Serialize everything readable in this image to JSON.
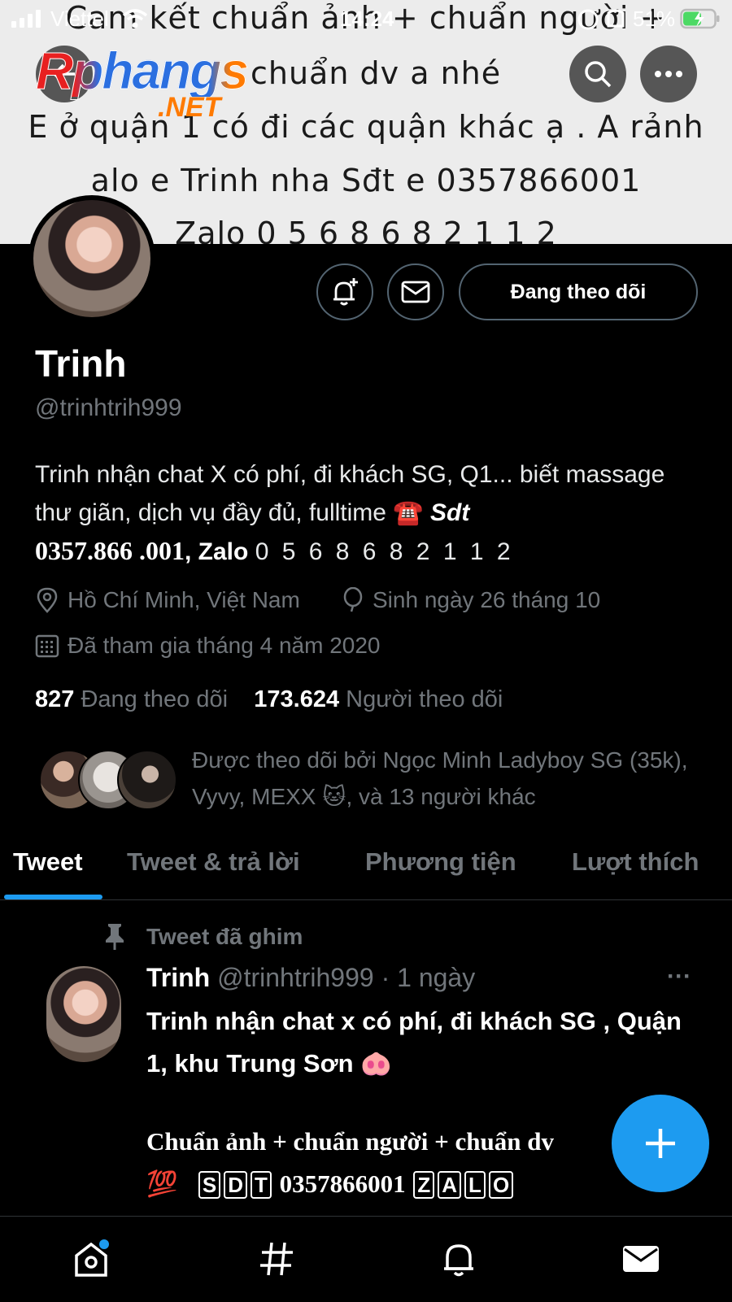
{
  "status_bar": {
    "carrier": "Viettel",
    "time": "14:24",
    "battery": "51%"
  },
  "banner": {
    "line1": "Cam kết chuẩn ảnh + chuẩn người +",
    "line2": "chuẩn dv a nhé",
    "line3": "E ở quận 1 có đi các quận khác ạ . A rảnh",
    "line4": "alo e Trinh nha Sđt e 0357866001",
    "line5": "Zalo 0 5 6 8 6 8 2 1 1 2"
  },
  "watermark": {
    "main": "Rphangs",
    "sub": ".NET"
  },
  "profile": {
    "follow_label": "Đang theo dõi",
    "name": "Trinh",
    "handle": "@trinhtrih999",
    "bio_1": "Trinh nhận chat X có phí, đi khách SG, Q1... biết massage thư giãn, dịch vụ đầy đủ, fulltime ☎️ ",
    "bio_sdt": "Sdt",
    "bio_2": "0357.866 .001",
    "bio_3": ", Zalo ",
    "bio_4": "0 5 6 8 6 8 2 1 1 2",
    "location": "Hồ Chí Minh, Việt Nam",
    "birthday": "Sinh ngày 26 tháng 10",
    "joined": "Đã tham gia tháng 4 năm 2020",
    "following_count": "827",
    "following_label": "Đang theo dõi",
    "followers_count": "173.624",
    "followers_label": "Người theo dõi",
    "followed_by": "Được theo dõi bởi Ngọc Minh Ladyboy SG (35k), Vyvy, MEXX 🐱, và 13 người khác"
  },
  "tabs": [
    {
      "label": "Tweet"
    },
    {
      "label": "Tweet & trả lời"
    },
    {
      "label": "Phương tiện"
    },
    {
      "label": "Lượt thích"
    }
  ],
  "tweet": {
    "pinned_label": "Tweet đã ghim",
    "name": "Trinh",
    "meta": "@trinhtrih999 · 1 ngày",
    "more": "···",
    "text_1": "Trinh nhận chat x có phí, đi khách SG , Quận 1,  khu Trung Sơn  🐽",
    "text_2": "Chuẩn ảnh + chuẩn người +  chuẩn dv",
    "emoji_100": "💯",
    "sdt_letters": [
      "S",
      "D",
      "T"
    ],
    "phone": "0357866001",
    "zalo_letters": [
      "Z",
      "A",
      "L",
      "O"
    ]
  },
  "colors": {
    "accent": "#1d9bf0",
    "muted": "#71767b",
    "background": "#000000"
  }
}
